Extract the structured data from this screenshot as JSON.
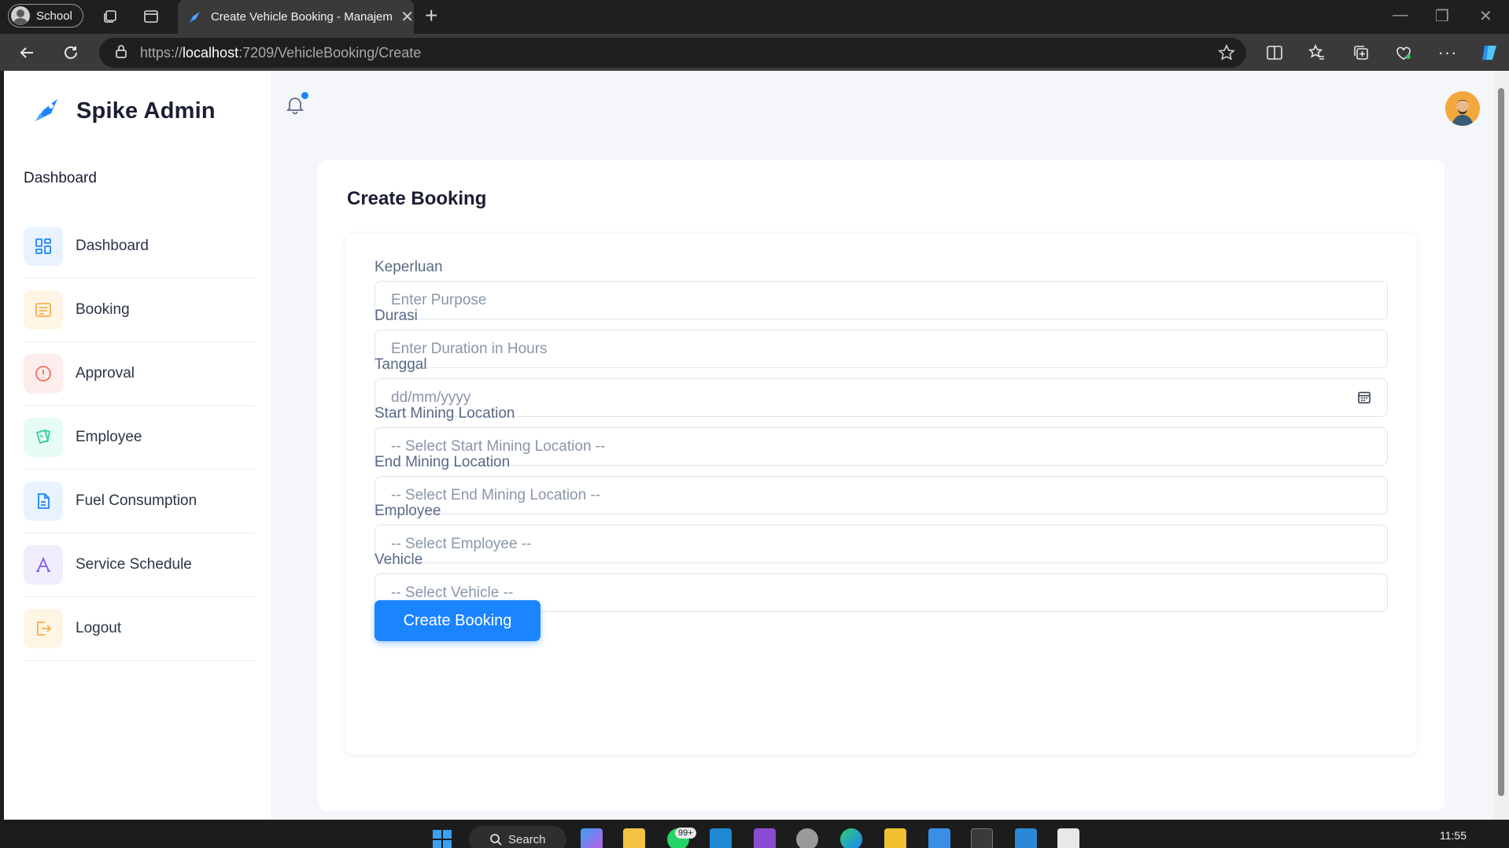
{
  "browser": {
    "profile_label": "School",
    "tab_title": "Create Vehicle Booking - Manajemen",
    "url_scheme": "https://",
    "url_host": "localhost",
    "url_path": ":7209/VehicleBooking/Create"
  },
  "sidebar": {
    "brand": "Spike Admin",
    "section_title": "Dashboard",
    "items": [
      {
        "label": "Dashboard",
        "icon": "dashboard-grid-icon",
        "bg": "#e8f3ff",
        "color": "#1b84ff"
      },
      {
        "label": "Booking",
        "icon": "list-icon",
        "bg": "#fef5e5",
        "color": "#f8b04a"
      },
      {
        "label": "Approval",
        "icon": "alert-circle-icon",
        "bg": "#fdeded",
        "color": "#f3705a"
      },
      {
        "label": "Employee",
        "icon": "cards-icon",
        "bg": "#e6fcf4",
        "color": "#2cd196"
      },
      {
        "label": "Fuel Consumption",
        "icon": "document-icon",
        "bg": "#e8f3ff",
        "color": "#1b84ff"
      },
      {
        "label": "Service Schedule",
        "icon": "typography-icon",
        "bg": "#f1edfd",
        "color": "#7a5af8"
      },
      {
        "label": "Logout",
        "icon": "logout-icon",
        "bg": "#fef5e5",
        "color": "#f8b04a"
      }
    ]
  },
  "main": {
    "card_title": "Create Booking",
    "fields": [
      {
        "label": "Keperluan",
        "placeholder": "Enter Purpose"
      },
      {
        "label": "Durasi",
        "placeholder": "Enter Duration in Hours"
      },
      {
        "label": "Tanggal",
        "placeholder": "dd/mm/yyyy"
      },
      {
        "label": "Start Mining Location",
        "placeholder": "-- Select Start Mining Location --"
      },
      {
        "label": "End Mining Location",
        "placeholder": "-- Select End Mining Location --"
      },
      {
        "label": "Employee",
        "placeholder": "-- Select Employee --"
      },
      {
        "label": "Vehicle",
        "placeholder": "-- Select Vehicle --"
      }
    ],
    "submit_label": "Create Booking"
  },
  "taskbar": {
    "search_label": "Search",
    "badge": "99+",
    "time": "11:55"
  },
  "colors": {
    "accent": "#1b84ff",
    "page_bg": "#f4f6fa"
  }
}
